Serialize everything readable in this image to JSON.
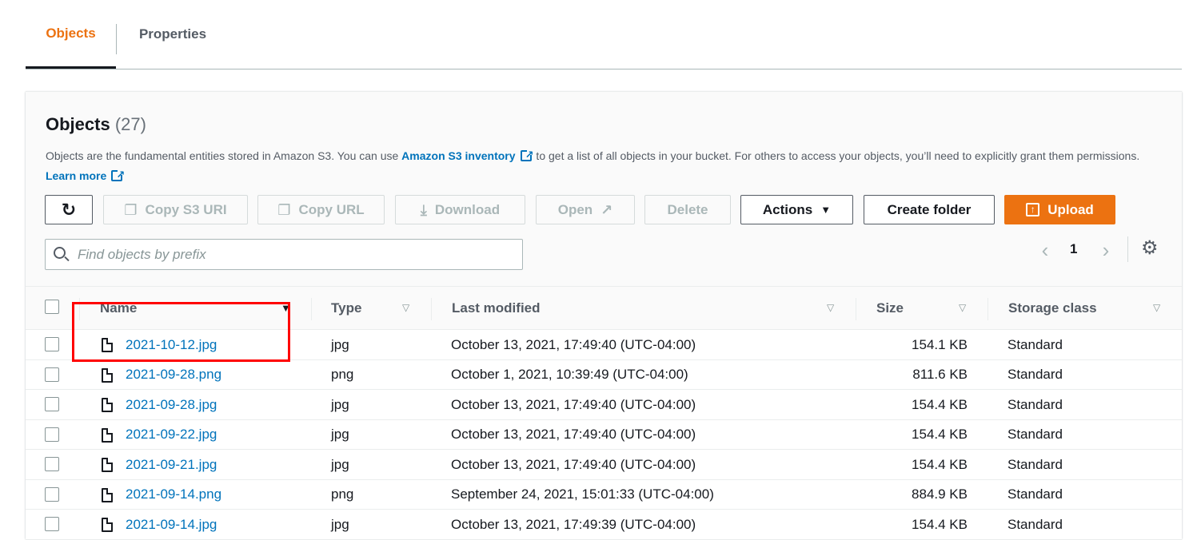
{
  "tabs": [
    {
      "label": "Objects",
      "active": true
    },
    {
      "label": "Properties",
      "active": false
    }
  ],
  "objects_panel": {
    "title": "Objects",
    "count": "(27)",
    "description_part1": "Objects are the fundamental entities stored in Amazon S3. You can use ",
    "inventory_link": "Amazon S3 inventory",
    "description_part2": " to get a list of all objects in your bucket. For others to access your objects, you’ll need to explicitly grant them permissions. ",
    "learn_more_link": "Learn more"
  },
  "toolbar": {
    "copy_s3_uri": "Copy S3 URI",
    "copy_url": "Copy URL",
    "download": "Download",
    "open": "Open",
    "delete": "Delete",
    "actions": "Actions",
    "create_folder": "Create folder",
    "upload": "Upload"
  },
  "search": {
    "placeholder": "Find objects by prefix",
    "value": ""
  },
  "pagination": {
    "current_page": "1"
  },
  "table": {
    "columns": {
      "name": "Name",
      "type": "Type",
      "last_modified": "Last modified",
      "size": "Size",
      "storage_class": "Storage class"
    },
    "rows": [
      {
        "name": "2021-10-12.jpg",
        "type": "jpg",
        "last_modified": "October 13, 2021, 17:49:40 (UTC-04:00)",
        "size": "154.1 KB",
        "storage_class": "Standard"
      },
      {
        "name": "2021-09-28.png",
        "type": "png",
        "last_modified": "October 1, 2021, 10:39:49 (UTC-04:00)",
        "size": "811.6 KB",
        "storage_class": "Standard"
      },
      {
        "name": "2021-09-28.jpg",
        "type": "jpg",
        "last_modified": "October 13, 2021, 17:49:40 (UTC-04:00)",
        "size": "154.4 KB",
        "storage_class": "Standard"
      },
      {
        "name": "2021-09-22.jpg",
        "type": "jpg",
        "last_modified": "October 13, 2021, 17:49:40 (UTC-04:00)",
        "size": "154.4 KB",
        "storage_class": "Standard"
      },
      {
        "name": "2021-09-21.jpg",
        "type": "jpg",
        "last_modified": "October 13, 2021, 17:49:40 (UTC-04:00)",
        "size": "154.4 KB",
        "storage_class": "Standard"
      },
      {
        "name": "2021-09-14.png",
        "type": "png",
        "last_modified": "September 24, 2021, 15:01:33 (UTC-04:00)",
        "size": "884.9 KB",
        "storage_class": "Standard"
      },
      {
        "name": "2021-09-14.jpg",
        "type": "jpg",
        "last_modified": "October 13, 2021, 17:49:39 (UTC-04:00)",
        "size": "154.4 KB",
        "storage_class": "Standard"
      }
    ]
  },
  "colors": {
    "accent": "#ec7211",
    "link": "#0073bb",
    "annotation": "#ff0000"
  }
}
